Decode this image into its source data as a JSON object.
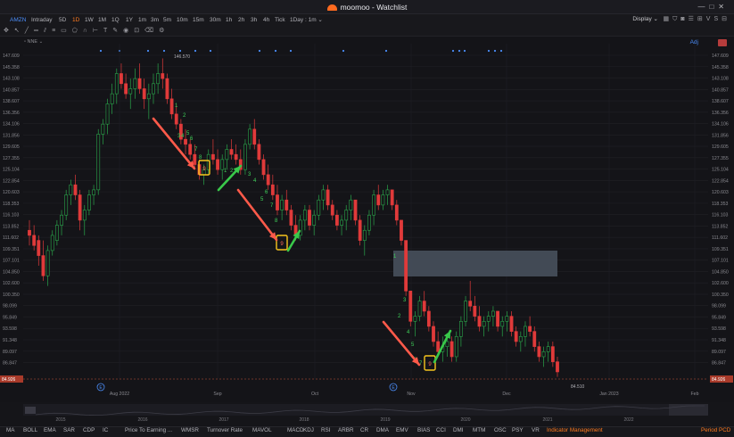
{
  "app": {
    "title": "moomoo - Watchlist"
  },
  "toolbar": {
    "ticker": "AMZN",
    "timeframes": [
      "Intraday",
      "5D",
      "1D",
      "1W",
      "1M",
      "1Q",
      "1Y",
      "1m",
      "3m",
      "5m",
      "10m",
      "15m",
      "30m",
      "1h",
      "2h",
      "3h",
      "4h",
      "Tick",
      "1Day : 1m"
    ],
    "active_timeframe": "1D",
    "display_label": "Display",
    "right_icons": [
      "grid-icon",
      "shirt-icon",
      "camera-icon",
      "list-icon",
      "plus-box-icon",
      "compare-icon",
      "more-icon"
    ]
  },
  "overlay": {
    "label": "NNE",
    "adj_label": "Adj"
  },
  "price_axis": {
    "labels": [
      "147.609",
      "145.358",
      "143.108",
      "140.857",
      "138.607",
      "136.356",
      "134.106",
      "131.856",
      "129.605",
      "127.355",
      "125.104",
      "122.854",
      "120.603",
      "118.353",
      "116.103",
      "113.852",
      "111.602",
      "109.351",
      "107.101",
      "104.850",
      "102.600",
      "100.350",
      "98.099",
      "95.849",
      "93.598",
      "91.348",
      "89.097",
      "86.847"
    ],
    "last_price": "84.926"
  },
  "time_axis": {
    "labels": [
      "Aug 2022",
      "Sep",
      "Oct",
      "Nov",
      "Dec",
      "Jan 2023",
      "Feb"
    ]
  },
  "overview_axis": {
    "labels": [
      "2015",
      "2016",
      "2017",
      "2018",
      "2019",
      "2020",
      "2021",
      "2022"
    ]
  },
  "annotations": {
    "high": "146.570",
    "low": "84.510"
  },
  "colors": {
    "up": "#2aa54a",
    "down": "#e03a3a",
    "accent": "#ff7a1f",
    "link": "#4b8df8",
    "seq": "#3fd35a",
    "marker": "#f7c51d",
    "arrow_red": "#ff5a4a",
    "arrow_green": "#39c84a",
    "zone": "#4a5360"
  },
  "seq_labels": [
    "1",
    "2",
    "3",
    "4",
    "5",
    "6",
    "7",
    "8",
    "9"
  ],
  "indicators": [
    "MA",
    "BOLL",
    "EMA",
    "SAR",
    "CDP",
    "IC",
    "Price To Earning ...",
    "WMSR",
    "Turnover Rate",
    "MAVOL",
    "MACD",
    "KDJ",
    "RSI",
    "ARBR",
    "CR",
    "DMA",
    "EMV",
    "BIAS",
    "CCI",
    "DMI",
    "MTM",
    "OSC",
    "PSY",
    "VR",
    "Indicator Management"
  ],
  "footer_right": [
    "Period",
    "PCD"
  ]
}
